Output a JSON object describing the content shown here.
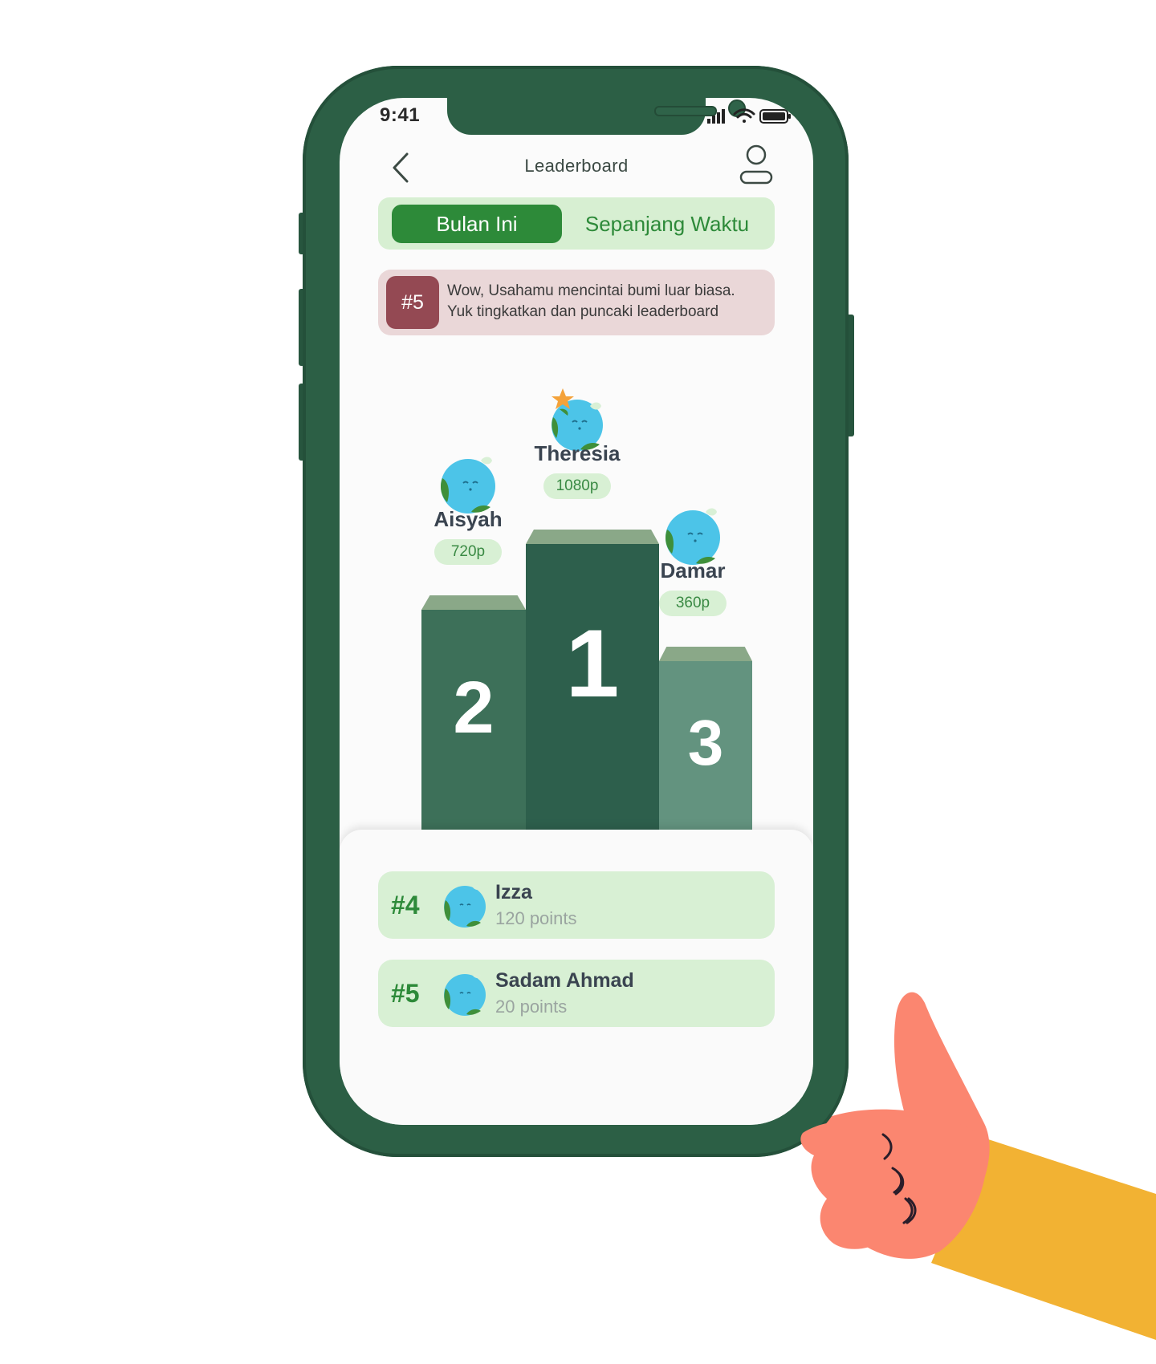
{
  "status_bar": {
    "time": "9:41"
  },
  "header": {
    "title": "Leaderboard"
  },
  "tabs": [
    {
      "label": "Bulan Ini",
      "active": true
    },
    {
      "label": "Sepanjang Waktu",
      "active": false
    }
  ],
  "banner": {
    "rank": "#5",
    "line1": "Wow, Usahamu mencintai bumi luar biasa.",
    "line2": "Yuk tingkatkan dan puncaki leaderboard"
  },
  "podium": [
    {
      "name": "Theresia",
      "points": "1080p",
      "place": "1"
    },
    {
      "name": "Aisyah",
      "points": "720p",
      "place": "2"
    },
    {
      "name": "Damar",
      "points": "360p",
      "place": "3"
    }
  ],
  "list": [
    {
      "rank": "#4",
      "name": "Izza",
      "points": "120 points"
    },
    {
      "rank": "#5",
      "name": "Sadam Ahmad",
      "points": "20 points"
    }
  ],
  "colors": {
    "frame": "#2c5f45",
    "accent_green": "#2d8a39",
    "tab_bg": "#d7efd2",
    "banner_bg": "#ead7d8",
    "banner_badge": "#944953",
    "podium_first": "#2d5f4c",
    "podium_second": "#3d7059",
    "podium_third": "#63937f",
    "sleeve": "#f2b233",
    "hand": "#fb8670"
  },
  "icons": [
    "back-chevron-icon",
    "profile-icon",
    "signal-icon",
    "wifi-icon",
    "battery-icon",
    "earth-avatar-icon",
    "star-icon"
  ]
}
